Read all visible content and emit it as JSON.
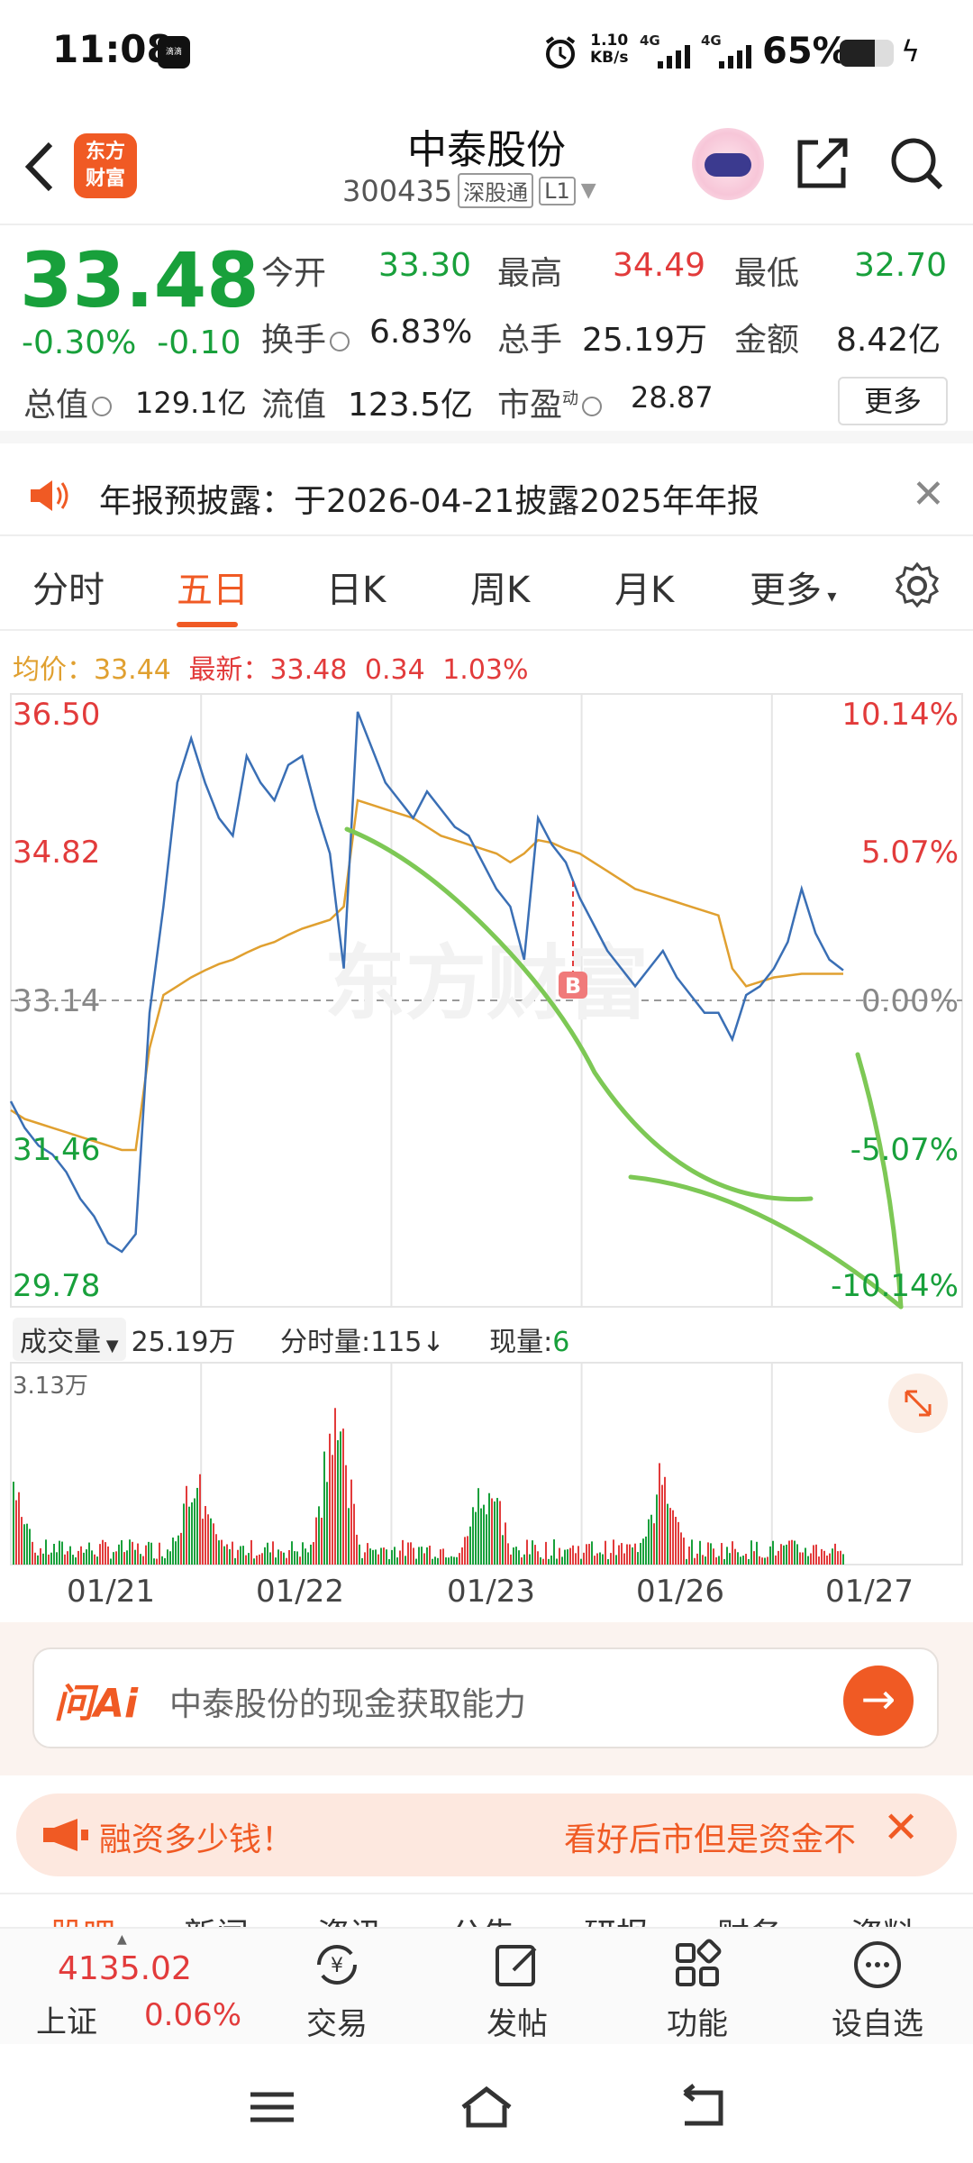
{
  "status": {
    "time": "11:08",
    "app_badge": "滴滴",
    "net_speed_value": "1.10",
    "net_speed_unit": "KB/s",
    "signal1": "4G",
    "signal2": "4G",
    "battery": "65%",
    "battery_level": 0.65
  },
  "header": {
    "title": "中泰股份",
    "code": "300435",
    "market_tag": "深股通",
    "level_tag": "L1",
    "logo_line1": "东方",
    "logo_line2": "财富"
  },
  "quote": {
    "price": "33.48",
    "change_pct": "-0.30%",
    "change_abs": "-0.10",
    "open_label": "今开",
    "open": "33.30",
    "high_label": "最高",
    "high": "34.49",
    "low_label": "最低",
    "low": "32.70",
    "turnover_label": "换手",
    "turnover": "6.83%",
    "volume_label": "总手",
    "volume": "25.19万",
    "amount_label": "金额",
    "amount": "8.42亿",
    "mktcap_label": "总值",
    "mktcap": "129.1亿",
    "float_label": "流值",
    "float": "123.5亿",
    "pe_label": "市盈",
    "pe_sup": "动",
    "pe": "28.87",
    "more": "更多"
  },
  "announcement": {
    "text": "年报预披露：于2026-04-21披露2025年年报",
    "close": "✕"
  },
  "tabs": {
    "items": [
      "分时",
      "五日",
      "日K",
      "周K",
      "月K",
      "更多"
    ],
    "active": 1
  },
  "chart_meta": {
    "avg_label": "均价：",
    "avg": "33.44",
    "latest_label": "最新：",
    "latest": "33.48",
    "chg": "0.34",
    "chg_pct": "1.03%",
    "watermark": "东方财富",
    "marker": "B"
  },
  "volume_meta": {
    "select": "成交量",
    "total": "25.19万",
    "tick_label": "分时量:",
    "tick": "115",
    "tick_arrow": "↓",
    "now_label": "现量:",
    "now": "6",
    "max": "3.13万"
  },
  "chart_data": {
    "type": "line",
    "x": [
      "01/21",
      "01/22",
      "01/23",
      "01/26",
      "01/27"
    ],
    "y_left_ticks": [
      "36.50",
      "34.82",
      "33.14",
      "31.46",
      "29.78"
    ],
    "y_right_ticks": [
      "10.14%",
      "5.07%",
      "0.00%",
      "-5.07%",
      "-10.14%"
    ],
    "ylim": [
      29.78,
      36.5
    ],
    "base": 33.14,
    "series": [
      {
        "values": [
          32.0,
          31.7,
          31.5,
          31.4,
          31.2,
          30.9,
          30.7,
          30.4,
          30.3,
          30.5,
          33.0,
          34.2,
          35.6,
          36.1,
          35.6,
          35.2,
          35.0,
          35.9,
          35.6,
          35.4,
          35.8,
          35.9,
          35.3,
          34.8,
          33.5,
          36.4,
          36.0,
          35.6,
          35.4,
          35.2,
          35.5,
          35.3,
          35.1,
          35.0,
          34.7,
          34.4,
          34.2,
          33.6,
          35.2,
          34.9,
          34.7,
          34.3,
          34.0,
          33.7,
          33.5,
          33.3,
          33.5,
          33.7,
          33.4,
          33.2,
          33.0,
          33.0,
          32.7,
          33.2,
          33.3,
          33.5,
          33.8,
          34.4,
          33.9,
          33.6,
          33.48
        ]
      },
      {
        "values": [
          31.9,
          31.8,
          31.75,
          31.7,
          31.65,
          31.6,
          31.55,
          31.5,
          31.45,
          31.45,
          32.6,
          33.2,
          33.3,
          33.4,
          33.48,
          33.55,
          33.6,
          33.68,
          33.75,
          33.8,
          33.88,
          33.95,
          34.0,
          34.05,
          34.2,
          35.4,
          35.35,
          35.3,
          35.25,
          35.2,
          35.1,
          35.0,
          34.95,
          34.9,
          34.85,
          34.8,
          34.7,
          34.8,
          34.95,
          34.92,
          34.85,
          34.8,
          34.7,
          34.6,
          34.5,
          34.4,
          34.35,
          34.3,
          34.25,
          34.2,
          34.15,
          34.1,
          33.5,
          33.3,
          33.35,
          33.4,
          33.42,
          33.44,
          33.44,
          33.44,
          33.44
        ]
      }
    ]
  },
  "ai": {
    "logo": "问Ai",
    "placeholder": "中泰股份的现金获取能力",
    "go": "→"
  },
  "promo": {
    "left": "融资多少钱！",
    "right": "看好后市但是资金不",
    "close": "✕"
  },
  "peek_tabs": [
    "股吧",
    "新闻",
    "资讯",
    "公告",
    "研报",
    "财务",
    "资料"
  ],
  "bottom": {
    "index_value": "4135.02",
    "index_name": "上证",
    "index_chg": "0.06%",
    "items": [
      "交易",
      "发帖",
      "功能",
      "设自选"
    ]
  },
  "colors": {
    "accent": "#f05a24",
    "up": "#e23b3b",
    "down": "#18a03b",
    "price_line": "#3a6fb5",
    "avg_line": "#e0a030",
    "annotation": "#7dc855"
  }
}
